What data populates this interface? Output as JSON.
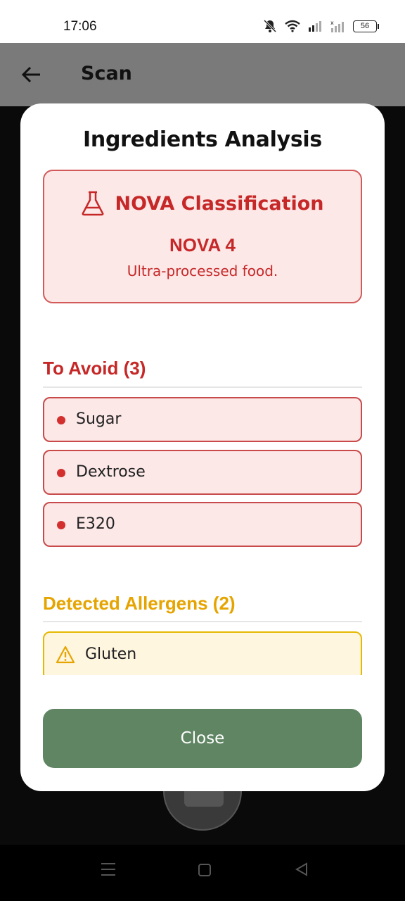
{
  "status_bar": {
    "time": "17:06",
    "battery": "56"
  },
  "app_bar": {
    "title": "Scan"
  },
  "dialog": {
    "title": "Ingredients Analysis",
    "nova": {
      "heading": "NOVA Classification",
      "value": "NOVA 4",
      "description": "Ultra-processed food."
    },
    "to_avoid": {
      "title": "To Avoid (3)",
      "items": [
        "Sugar",
        "Dextrose",
        "E320"
      ]
    },
    "allergens": {
      "title": "Detected Allergens (2)",
      "items": [
        "Gluten"
      ]
    },
    "close_label": "Close"
  },
  "colors": {
    "danger": "#c62828",
    "warning": "#e6a400",
    "primary_button": "#5f8563"
  }
}
